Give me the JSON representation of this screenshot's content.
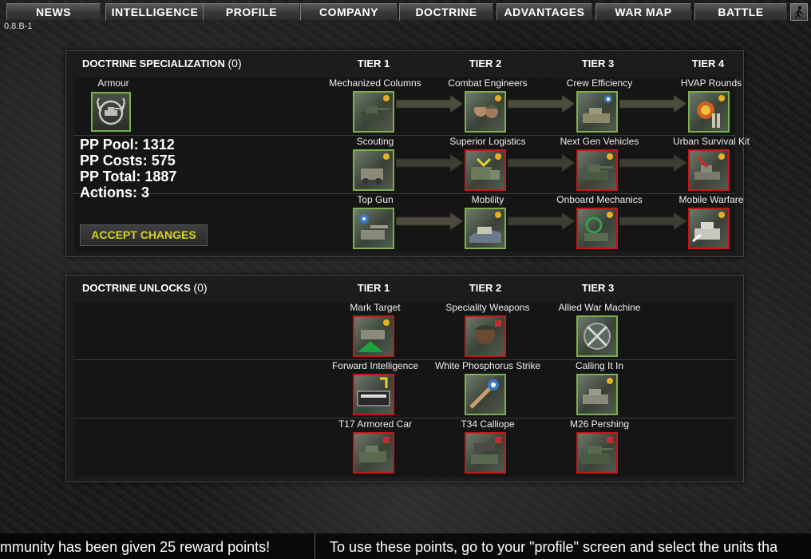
{
  "nav": {
    "items": [
      "NEWS",
      "INTELLIGENCE",
      "PROFILE",
      "COMPANY",
      "DOCTRINE",
      "ADVANTAGES",
      "WAR MAP",
      "BATTLE"
    ]
  },
  "version": "0.8.B-1",
  "specialization": {
    "title": "DOCTRINE SPECIALIZATION",
    "count": "(0)",
    "tiers": [
      "TIER 1",
      "TIER 2",
      "TIER 3",
      "TIER 4"
    ],
    "doctrine_name": "Armour",
    "stats": {
      "pp_pool": "PP Pool: 1312",
      "pp_costs": "PP Costs: 575",
      "pp_total": "PP Total: 1887",
      "actions": "Actions: 3"
    },
    "accept_label": "ACCEPT CHANGES",
    "rows": [
      [
        {
          "label": "Mechanized Columns",
          "state": "unlocked"
        },
        {
          "label": "Combat Engineers",
          "state": "unlocked"
        },
        {
          "label": "Crew Efficiency",
          "state": "unlocked"
        },
        {
          "label": "HVAP Rounds",
          "state": "unlocked"
        }
      ],
      [
        {
          "label": "Scouting",
          "state": "unlocked"
        },
        {
          "label": "Superior Logistics",
          "state": "locked"
        },
        {
          "label": "Next Gen Vehicles",
          "state": "locked"
        },
        {
          "label": "Urban Survival Kit",
          "state": "locked"
        }
      ],
      [
        {
          "label": "Top Gun",
          "state": "unlocked"
        },
        {
          "label": "Mobility",
          "state": "unlocked"
        },
        {
          "label": "Onboard Mechanics",
          "state": "locked"
        },
        {
          "label": "Mobile Warfare",
          "state": "locked"
        }
      ]
    ]
  },
  "unlocks": {
    "title": "DOCTRINE UNLOCKS",
    "count": "(0)",
    "tiers": [
      "TIER 1",
      "TIER 2",
      "TIER 3"
    ],
    "rows": [
      [
        {
          "label": "Mark Target",
          "state": "locked"
        },
        {
          "label": "Speciality Weapons",
          "state": "locked"
        },
        {
          "label": "Allied War Machine",
          "state": "unlocked"
        }
      ],
      [
        {
          "label": "Forward Intelligence",
          "state": "locked"
        },
        {
          "label": "White Phosphorus Strike",
          "state": "unlocked"
        },
        {
          "label": "Calling It In",
          "state": "unlocked"
        }
      ],
      [
        {
          "label": "T17 Armored Car",
          "state": "locked"
        },
        {
          "label": "T34 Calliope",
          "state": "locked"
        },
        {
          "label": "M26 Pershing",
          "state": "locked"
        }
      ]
    ]
  },
  "ticker": {
    "left": "mmunity has been given 25 reward points!",
    "right": "To use these points, go to your \"profile\" screen and select the units tha"
  },
  "colors": {
    "unlocked_border": "#7ab04a",
    "locked_border": "#c41818",
    "accept_text": "#d8d428"
  }
}
